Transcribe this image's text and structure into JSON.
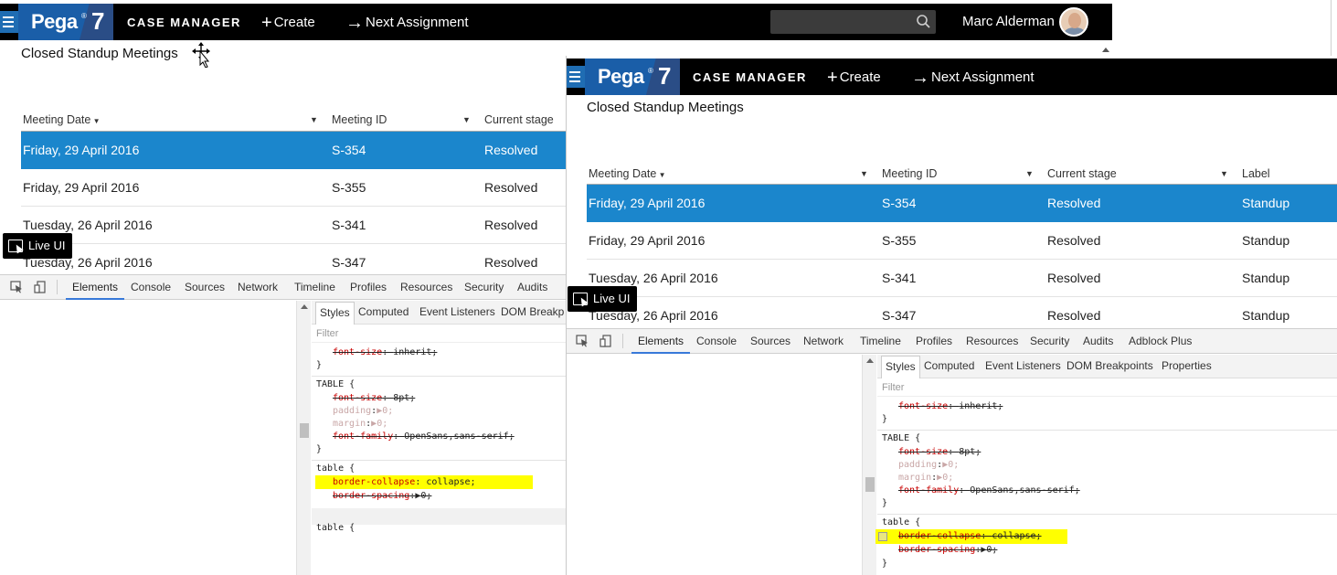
{
  "header": {
    "logo_text": "Pega",
    "logo_sup": "®",
    "logo_version": "7",
    "app_name": "CASE MANAGER",
    "create_label": "Create",
    "next_assignment_label": "Next Assignment",
    "user_name": "Marc Alderman"
  },
  "page_title": "Closed Standup Meetings",
  "table": {
    "columns": [
      "Meeting Date",
      "Meeting ID",
      "Current stage",
      "Label"
    ],
    "rows": [
      {
        "date": "Friday, 29 April 2016",
        "id": "S-354",
        "stage": "Resolved",
        "label": "Standup"
      },
      {
        "date": "Friday, 29 April 2016",
        "id": "S-355",
        "stage": "Resolved",
        "label": "Standup"
      },
      {
        "date": "Tuesday, 26 April 2016",
        "id": "S-341",
        "stage": "Resolved",
        "label": "Standup"
      },
      {
        "date": "Tuesday, 26 April 2016",
        "id": "S-347",
        "stage": "Resolved",
        "label": "Standup"
      }
    ],
    "selected_row": 0
  },
  "live_ui_label": "Live UI",
  "devtools": {
    "tabs_left": [
      "Elements",
      "Console",
      "Sources",
      "Network",
      "Timeline",
      "Profiles",
      "Resources",
      "Security",
      "Audits"
    ],
    "tabs_right": [
      "Elements",
      "Console",
      "Sources",
      "Network",
      "Timeline",
      "Profiles",
      "Resources",
      "Security",
      "Audits",
      "Adblock Plus"
    ],
    "active_tab": "Elements",
    "sidebar_tabs_left": [
      "Styles",
      "Computed",
      "Event Listeners",
      "DOM Breakp"
    ],
    "sidebar_tabs_right": [
      "Styles",
      "Computed",
      "Event Listeners",
      "DOM Breakpoints",
      "Properties"
    ],
    "filter_placeholder": "Filter",
    "css": {
      "font_size_inherit": {
        "name": "font-size",
        "value": "inherit;"
      },
      "table_upper_selector": "TABLE {",
      "table_upper_props": [
        {
          "name": "font-size",
          "value": "8pt;",
          "style": "strike"
        },
        {
          "name": "padding",
          "value": "0;",
          "style": "disabled"
        },
        {
          "name": "margin",
          "value": "0;",
          "style": "disabled"
        },
        {
          "name": "font-family",
          "value": "OpenSans,sans-serif;",
          "style": "strike"
        }
      ],
      "table_lower_selector": "table {",
      "border_collapse": {
        "name": "border-collapse",
        "value": "collapse;"
      },
      "border_spacing": {
        "name": "border-spacing",
        "value": "0;"
      },
      "close_brace": "}",
      "expand_arrow": "▶"
    }
  },
  "colors": {
    "header_bg": "#000000",
    "logo_blue": "#1a5ea8",
    "selected_row": "#1b86cc",
    "highlight": "#ffff00",
    "css_prop_red": "#c80000"
  }
}
